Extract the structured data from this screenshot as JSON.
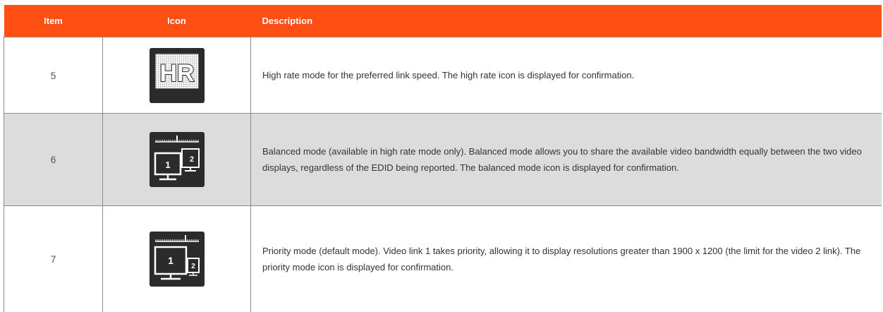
{
  "table": {
    "headers": {
      "item": "Item",
      "icon": "Icon",
      "description": "Description"
    },
    "rows": [
      {
        "item": "5",
        "icon": "high-rate-icon",
        "icon_text": "HR",
        "description": "High rate mode for the preferred link speed. The high rate icon is displayed for confirmation."
      },
      {
        "item": "6",
        "icon": "balanced-mode-icon",
        "icon_text_primary": "1",
        "icon_text_secondary": "2",
        "description": "Balanced mode (available in high rate mode only). Balanced mode allows you to share the available video bandwidth equally between the two video displays, regardless of the EDID being reported. The balanced mode icon is displayed for confirmation."
      },
      {
        "item": "7",
        "icon": "priority-mode-icon",
        "icon_text_primary": "1",
        "icon_text_secondary": "2",
        "description": "Priority mode (default mode). Video link 1 takes priority, allowing it to display resolutions greater than 1900 x 1200 (the limit for the video 2 link). The priority mode icon is displayed for confirmation."
      }
    ]
  },
  "colors": {
    "header_bg": "#ff4f13",
    "header_text": "#ffffff",
    "alt_row_bg": "#dcdcdc",
    "icon_bg": "#2b2b2b"
  }
}
